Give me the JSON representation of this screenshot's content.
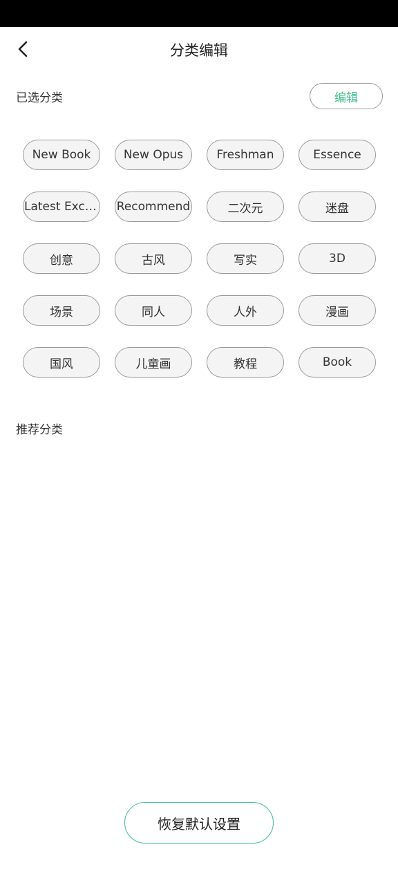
{
  "header": {
    "title": "分类编辑",
    "back_icon": "chevron-left-icon"
  },
  "selected": {
    "title": "已选分类",
    "edit_label": "编辑",
    "edit_color": "#3dbf8a",
    "tags": [
      "New Book",
      "New Opus",
      "Freshman",
      "Essence",
      "Latest Excel..",
      "Recommend",
      "二次元",
      "迷盘",
      "创意",
      "古风",
      "写实",
      "3D",
      "场景",
      "同人",
      "人外",
      "漫画",
      "国风",
      "儿童画",
      "教程",
      "Book"
    ]
  },
  "recommended": {
    "title": "推荐分类"
  },
  "footer": {
    "restore_label": "恢复默认设置",
    "accent_color": "#3dbf9a"
  }
}
